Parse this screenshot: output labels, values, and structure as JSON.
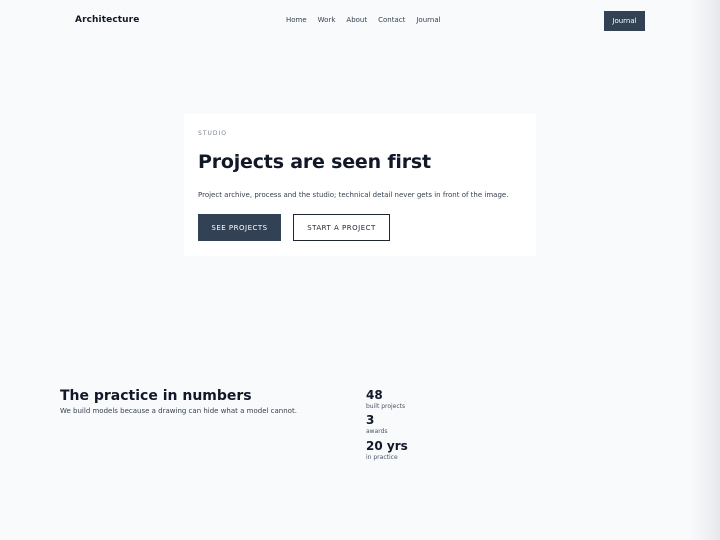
{
  "nav": {
    "brand": "Architecture",
    "links": [
      "Home",
      "Work",
      "About",
      "Contact",
      "Journal"
    ],
    "cta_label": "Journal"
  },
  "hero": {
    "eyebrow": "STUDIO",
    "title": "Projects are seen first",
    "lede": "Project archive, process and the studio; technical detail never gets in front of the image.",
    "primary_label": "SEE PROJECTS",
    "secondary_label": "START A PROJECT"
  },
  "stats": {
    "title": "The practice in numbers",
    "subtitle": "We build models because a drawing can hide what a model cannot.",
    "items": [
      {
        "value": "48",
        "label": "built projects"
      },
      {
        "value": "3",
        "label": "awards"
      },
      {
        "value": "20 yrs",
        "label": "in practice"
      }
    ]
  },
  "colors": {
    "accent": "#334155",
    "background": "#f8fafc",
    "card": "#ffffff",
    "text": "#111827"
  }
}
